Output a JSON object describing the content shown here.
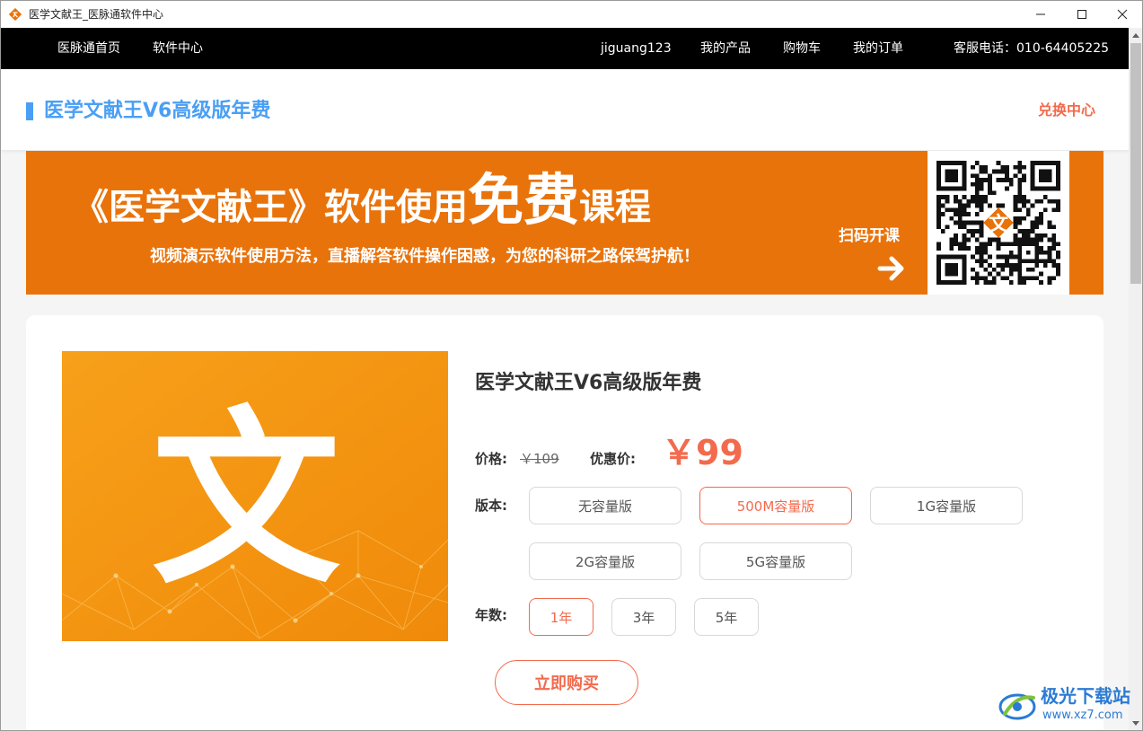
{
  "window": {
    "title": "医学文献王_医脉通软件中心",
    "minimize_glyph": "—",
    "maximize_glyph": "☐",
    "close_glyph": "✕"
  },
  "topnav": {
    "home": "医脉通首页",
    "software_center": "软件中心",
    "username": "jiguang123",
    "my_products": "我的产品",
    "cart": "购物车",
    "my_orders": "我的订单",
    "hotline": "客服电话：010-64405225"
  },
  "header": {
    "title": "医学文献王V6高级版年费",
    "redeem_link": "兑换中心"
  },
  "banner": {
    "title_part1": "《医学文献王》软件使用",
    "title_big": "免费",
    "title_part2": "课程",
    "subtitle": "视频演示软件使用方法，直播解答软件操作困惑，为您的科研之路保驾护航！",
    "scan_text": "扫码开课",
    "qr_center_char": "文"
  },
  "product": {
    "image_char": "文",
    "title": "医学文献王V6高级版年费",
    "price_label": "价格:",
    "original_price": "￥109",
    "discount_label": "优惠价:",
    "sale_price": "￥99",
    "edition_label": "版本:",
    "editions": [
      "无容量版",
      "500M容量版",
      "1G容量版",
      "2G容量版",
      "5G容量版"
    ],
    "selected_edition": "500M容量版",
    "years_label": "年数:",
    "years": [
      "1年",
      "3年",
      "5年"
    ],
    "selected_year": "1年",
    "buy_button": "立即购买"
  },
  "watermark": {
    "name": "极光下载站",
    "url": "www.xz7.com"
  },
  "colors": {
    "accent_blue": "#4a9ff5",
    "accent_red": "#f36a4d",
    "banner_orange": "#e9730b",
    "nav_black": "#000000"
  },
  "icons": {
    "app": "app-logo-icon",
    "arrow": "arrow-right-icon",
    "qr": "qr-code-icon"
  }
}
